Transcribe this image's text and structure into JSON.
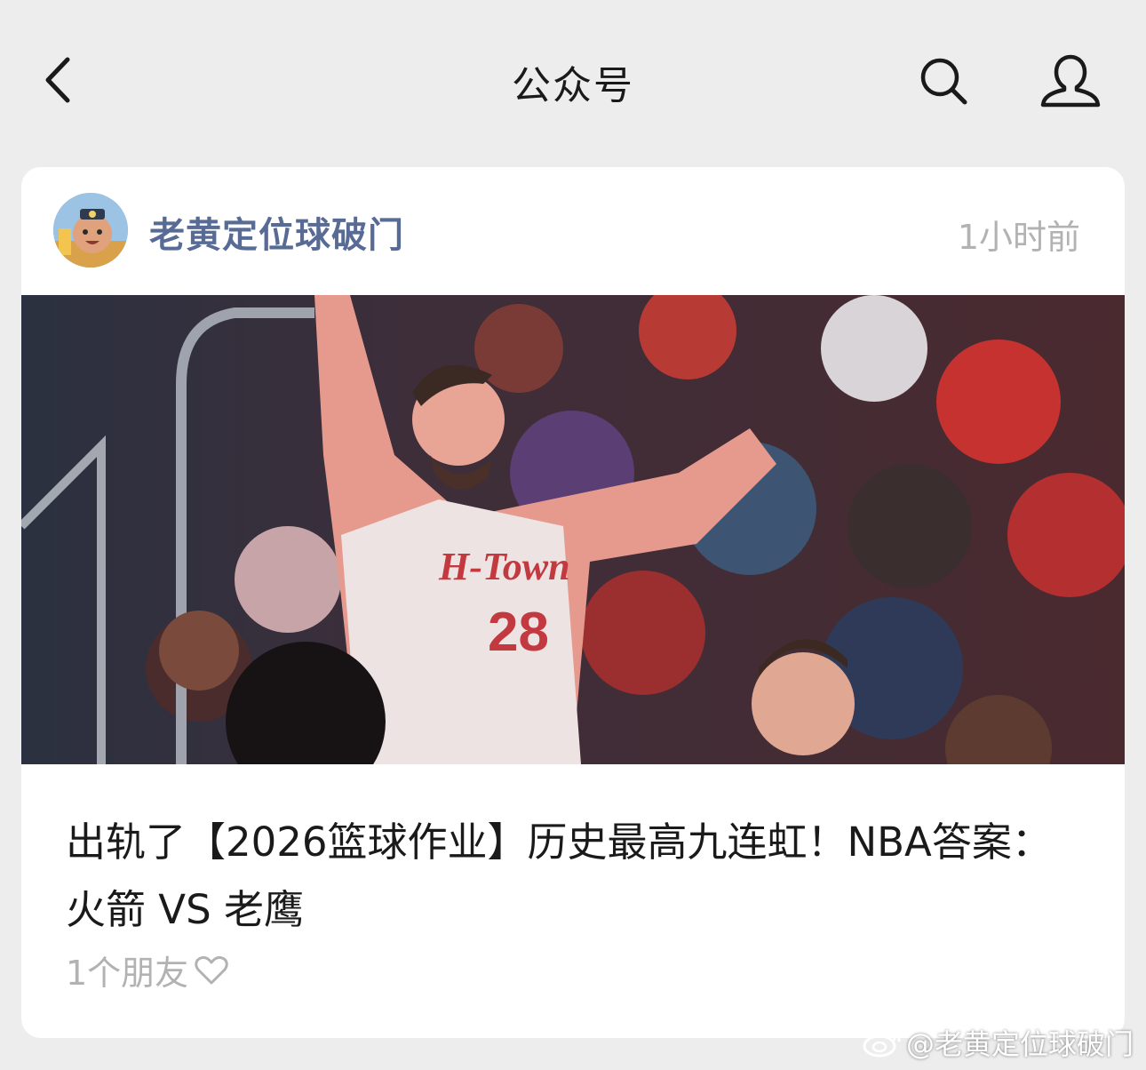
{
  "nav": {
    "title": "公众号",
    "back_icon": "chevron-left-icon",
    "search_icon": "search-icon",
    "profile_icon": "person-icon"
  },
  "card": {
    "account_name": "老黄定位球破门",
    "time": "1小时前",
    "article_title": "出轨了【2026篮球作业】历史最高九连虹！NBA答案：火箭 VS 老鹰",
    "friends": "1个朋友",
    "friends_icon": "heart-outline-icon",
    "cover_jersey_text": "H-Town",
    "cover_jersey_number": "28"
  },
  "watermark": {
    "text": "@老黄定位球破门",
    "icon": "weibo-icon"
  },
  "colors": {
    "background": "#ededed",
    "card": "#ffffff",
    "link": "#576b95",
    "muted": "#b2b2b2",
    "text": "#1a1a1a"
  }
}
